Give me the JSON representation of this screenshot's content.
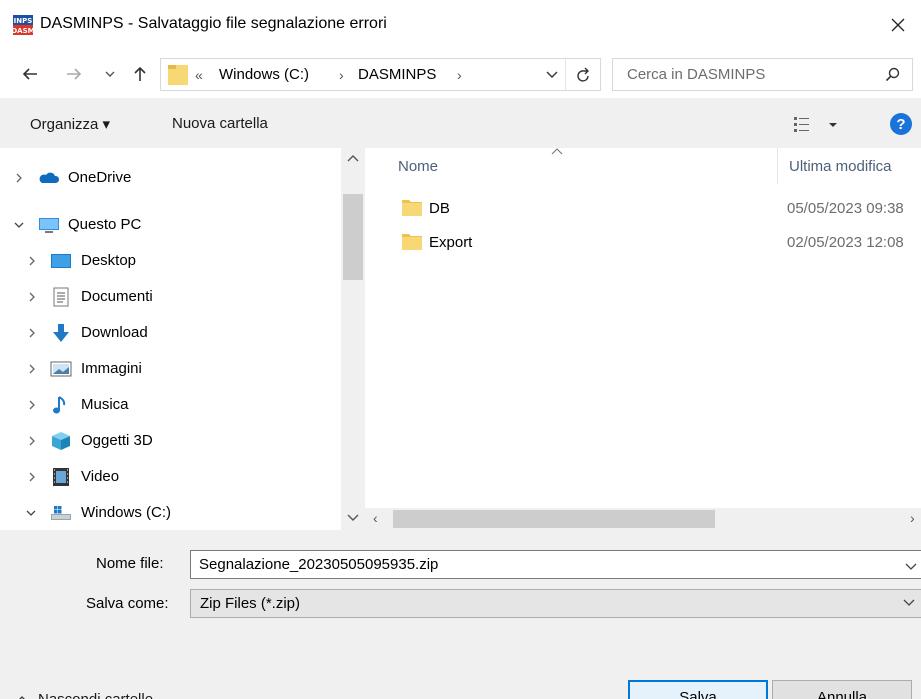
{
  "window": {
    "title": "DASMINPS - Salvataggio file segnalazione errori",
    "app_icon_text_top": "INPS",
    "app_icon_text_bottom": "DASM"
  },
  "navigation": {
    "breadcrumb_overflow": "«",
    "breadcrumb": [
      "Windows (C:)",
      "DASMINPS"
    ],
    "search_placeholder": "Cerca in DASMINPS"
  },
  "toolbar": {
    "organize_label": "Organizza ▾",
    "new_folder_label": "Nuova cartella",
    "help_label": "?"
  },
  "tree": [
    {
      "label": "OneDrive",
      "icon": "cloud-icon",
      "expanded": false,
      "level": 0
    },
    {
      "label": "Questo PC",
      "icon": "computer-icon",
      "expanded": true,
      "level": 0
    },
    {
      "label": "Desktop",
      "icon": "desktop-icon",
      "expanded": false,
      "level": 1
    },
    {
      "label": "Documenti",
      "icon": "document-icon",
      "expanded": false,
      "level": 1
    },
    {
      "label": "Download",
      "icon": "download-icon",
      "expanded": false,
      "level": 1
    },
    {
      "label": "Immagini",
      "icon": "pictures-icon",
      "expanded": false,
      "level": 1
    },
    {
      "label": "Musica",
      "icon": "music-icon",
      "expanded": false,
      "level": 1
    },
    {
      "label": "Oggetti 3D",
      "icon": "cube-icon",
      "expanded": false,
      "level": 1
    },
    {
      "label": "Video",
      "icon": "video-icon",
      "expanded": false,
      "level": 1
    },
    {
      "label": "Windows (C:)",
      "icon": "drive-icon",
      "expanded": true,
      "level": 1
    }
  ],
  "file_list": {
    "columns": [
      "Nome",
      "Ultima modifica"
    ],
    "rows": [
      {
        "name": "DB",
        "modified": "05/05/2023 09:38"
      },
      {
        "name": "Export",
        "modified": "02/05/2023 12:08"
      }
    ]
  },
  "save_form": {
    "filename_label": "Nome file:",
    "filename_value": "Segnalazione_20230505095935.zip",
    "save_as_label": "Salva come:",
    "save_as_value": "Zip Files (*.zip)",
    "hide_folders_label": "Nascondi cartelle",
    "save_button": "Salva",
    "cancel_button": "Annulla"
  },
  "colors": {
    "accent": "#0078d7",
    "folder": "#f8d775",
    "help": "#1a73d9",
    "panel": "#f0f0f0"
  }
}
